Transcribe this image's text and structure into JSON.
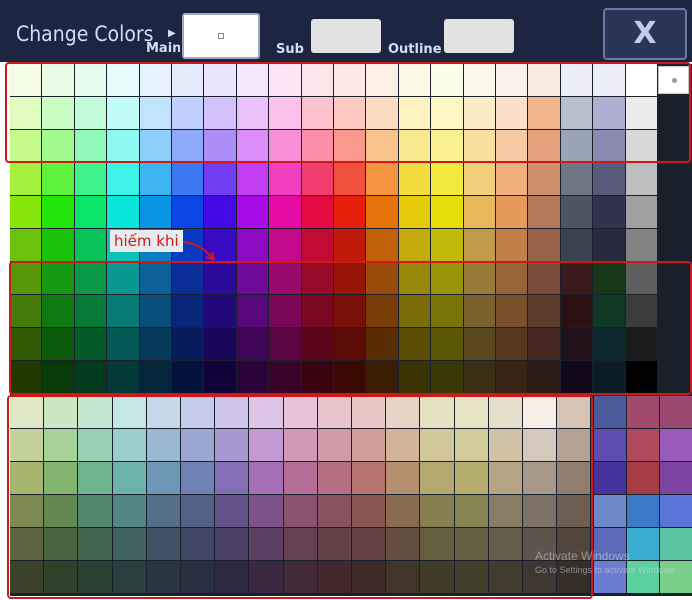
{
  "header": {
    "title": "Change Colors",
    "main_label": "Main",
    "sub_label": "Sub",
    "outline_label": "Outline",
    "close_label": "X",
    "main_color": "#ffffff",
    "sub_color": "#e2e2e2",
    "outline_color": "#e2e2e2"
  },
  "annotation": {
    "text": "hiếm khi",
    "color": "#d01818"
  },
  "watermark": {
    "line1": "Activate Windows",
    "line2": "Go to Settings to activate Windows."
  },
  "palette": {
    "rows_top": [
      [
        "#f4fce6",
        "#eafce6",
        "#e6fcef",
        "#e6fcfb",
        "#e6f2fc",
        "#e6ebfc",
        "#ece6fc",
        "#f5e6fc",
        "#fce6f6",
        "#fce6ec",
        "#fce8e6",
        "#fcf0e6",
        "#fcfae6",
        "#fcfde6",
        "#fcf8e8",
        "#fcf1e8",
        "#fae9e0",
        "#eeeef6",
        "#eeeef9",
        "#ffffff"
      ],
      [
        "#e0fcbf",
        "#cbfcc2",
        "#c1fcd9",
        "#c1fcf7",
        "#c1e4fc",
        "#c1cffc",
        "#d3c1fc",
        "#ebc1fc",
        "#fcc1ea",
        "#fcc1ce",
        "#fcc8c1",
        "#fcdcc1",
        "#fcf3c1",
        "#fcf6c3",
        "#fcecc6",
        "#fcdfc6",
        "#f1b78a",
        "#b8c0d0",
        "#b0aed0",
        "#ececec"
      ],
      [
        "#c5f98a",
        "#a2f98e",
        "#8ef9b9",
        "#8ef9f1",
        "#8ecff9",
        "#8eaaf9",
        "#ad8ef9",
        "#db8ef9",
        "#f98ed8",
        "#f98ea6",
        "#f9998e",
        "#f9c38e",
        "#f9e98e",
        "#f9f08e",
        "#f9dfa0",
        "#f7c9a2",
        "#e4a27c",
        "#9aa5b5",
        "#8a8ab0",
        "#d8d8d8"
      ]
    ],
    "rows_mid": [
      [
        "#a5f23e",
        "#5cf23e",
        "#3ef28d",
        "#3ef2e7",
        "#3eb4f2",
        "#3e77f2",
        "#723ef2",
        "#c33ef2",
        "#f23ec0",
        "#f23e6e",
        "#f2503e",
        "#f2953e",
        "#f2dc3e",
        "#f2ea3e",
        "#f2cf7a",
        "#f0b07e",
        "#cf8f6a",
        "#6e7585",
        "#5a5a7c",
        "#bebebe"
      ],
      [
        "#86e60a",
        "#22e60a",
        "#0ae66a",
        "#0ae6da",
        "#0a94e6",
        "#0a45e6",
        "#430ae6",
        "#a70ae6",
        "#e60aa4",
        "#e60a40",
        "#e61f0a",
        "#e6720a",
        "#e6cb0a",
        "#e6dd0a",
        "#e6b85a",
        "#e59a5a",
        "#b4785a",
        "#4d5462",
        "#33334d",
        "#a0a0a0"
      ],
      [
        "#6cc20a",
        "#1bc20a",
        "#0ac25a",
        "#0ac2b8",
        "#0a7cc2",
        "#0a39c2",
        "#380ac2",
        "#8c0ac2",
        "#c20a8a",
        "#c20a35",
        "#c21a0a",
        "#c2600a",
        "#c2ab0a",
        "#c2ba0a",
        "#c29b48",
        "#c08048",
        "#96624a",
        "#3a414f",
        "#2a2a3e",
        "#828282"
      ]
    ],
    "rows_dark": [
      [
        "#55990a",
        "#159915",
        "#0a9947",
        "#0a9991",
        "#0a6199",
        "#0a2e99",
        "#2c0a99",
        "#6e0a99",
        "#990a6d",
        "#990a29",
        "#99150a",
        "#994c0a",
        "#99870a",
        "#99930a",
        "#997a38",
        "#976438",
        "#7a4e3a",
        "#3a1a1a",
        "#17391a",
        "#5e5e5e"
      ],
      [
        "#447a08",
        "#0f7a10",
        "#087a38",
        "#087a74",
        "#084e7a",
        "#08257a",
        "#23087a",
        "#58087a",
        "#7a0857",
        "#7a0821",
        "#7a1108",
        "#7a3d08",
        "#7a6c08",
        "#7a7508",
        "#7a622c",
        "#78502c",
        "#5e3c2c",
        "#2c1014",
        "#123826",
        "#3c3c3c"
      ],
      [
        "#325a05",
        "#0a5a0a",
        "#055a29",
        "#055a55",
        "#053a5a",
        "#051b5a",
        "#19055a",
        "#41055a",
        "#5a0540",
        "#5a0518",
        "#5a0c05",
        "#5a2d05",
        "#5a4f05",
        "#5a5605",
        "#5a481f",
        "#58381f",
        "#44281f",
        "#201018",
        "#0e2a30",
        "#1c1c1c"
      ],
      [
        "#213a03",
        "#073a07",
        "#033a1b",
        "#033a37",
        "#03263a",
        "#03123a",
        "#10033a",
        "#2a033a",
        "#3a0329",
        "#3a0310",
        "#3a0803",
        "#3a1d03",
        "#3a3303",
        "#3a3803",
        "#3a2f14",
        "#382414",
        "#2c1a14",
        "#12081a",
        "#0a1c28",
        "#000000"
      ]
    ],
    "rows_muted": [
      [
        "#dfe7c4",
        "#cde7c4",
        "#c4e7d2",
        "#c4e6e4",
        "#c4d8e7",
        "#c4cce7",
        "#cdc4e7",
        "#dec4e7",
        "#e7c4da",
        "#e7c4cc",
        "#e7c8c4",
        "#e7d4c4",
        "#e7e1c4",
        "#e7e4c4",
        "#e7dfcb",
        "#f7eee6",
        "#d6c4b4",
        "#4c5a9c",
        "#a04a6c",
        "#9a4870"
      ],
      [
        "#c4d19a",
        "#a8d19a",
        "#9ad1b2",
        "#9acfcb",
        "#9ab8d1",
        "#9aa8d1",
        "#a89ad1",
        "#c29ad1",
        "#d19ab8",
        "#d19aa8",
        "#d19f9a",
        "#d1b49a",
        "#d1c79a",
        "#d1cc9a",
        "#d1c3a6",
        "#d4c8bc",
        "#b4a292",
        "#5e4cb0",
        "#b04a5e",
        "#9a5ab8"
      ],
      [
        "#a7b56e",
        "#84b56e",
        "#6eb58d",
        "#6eb2ae",
        "#6e96b5",
        "#6e82b5",
        "#846eb5",
        "#a56eb5",
        "#b56e96",
        "#b56e82",
        "#b5746e",
        "#b5906e",
        "#b5a86e",
        "#b5ae6e",
        "#b5a585",
        "#a8988a",
        "#927e6e",
        "#46349c",
        "#a83c44",
        "#7c44a0"
      ],
      [
        "#7d8852",
        "#638852",
        "#528869",
        "#528583",
        "#527088",
        "#526188",
        "#635288",
        "#7c5288",
        "#885270",
        "#885261",
        "#885752",
        "#886c52",
        "#887e52",
        "#888352",
        "#887c64",
        "#7e7268",
        "#6e5e52",
        "#6c88c8",
        "#3a7ac8",
        "#5a74d8"
      ],
      [
        "#5c6440",
        "#496440",
        "#40644d",
        "#406260",
        "#405264",
        "#404764",
        "#494064",
        "#5b4064",
        "#644052",
        "#644047",
        "#644040",
        "#645040",
        "#645d40",
        "#646040",
        "#645b4a",
        "#5e544c",
        "#52463c",
        "#5a6ab8",
        "#3aaed0",
        "#58c4a0"
      ],
      [
        "#3c4129",
        "#2f4129",
        "#294132",
        "#29403e",
        "#293641",
        "#292e41",
        "#2f2941",
        "#3b2941",
        "#412935",
        "#41292e",
        "#412b29",
        "#413429",
        "#413c29",
        "#413e29",
        "#413b30",
        "#3e3732",
        "#352e27",
        "#6c7cd0",
        "#58d0a0",
        "#7ad08a"
      ]
    ],
    "right_side": {
      "top_cols_note": "last three columns of first panel rows use separate swatches"
    }
  }
}
